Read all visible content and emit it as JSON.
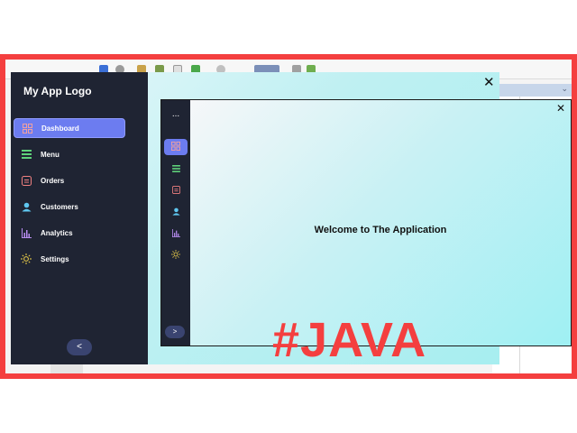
{
  "app": {
    "logo": "My App Logo",
    "sidebar_items": [
      {
        "label": "Dashboard",
        "icon": "grid-icon"
      },
      {
        "label": "Menu",
        "icon": "menu-icon"
      },
      {
        "label": "Orders",
        "icon": "orders-icon"
      },
      {
        "label": "Customers",
        "icon": "user-icon"
      },
      {
        "label": "Analytics",
        "icon": "chart-icon"
      },
      {
        "label": "Settings",
        "icon": "sun-icon"
      }
    ],
    "collapse_label": "<",
    "close_label": "✕"
  },
  "mini": {
    "dots": "...",
    "expand_label": ">",
    "close_label": "✕",
    "welcome": "Welcome to The Application"
  },
  "watermark": "#JAVA",
  "colors": {
    "frame": "#f43f3f",
    "sidebar": "#1f2433",
    "active": "#6c7cf0",
    "icon_grid": "#f0a0a0",
    "icon_menu": "#5fd27a",
    "icon_orders": "#f08080",
    "icon_user": "#5fc7f0",
    "icon_chart": "#b78cf0",
    "icon_sun": "#f2d34a"
  }
}
